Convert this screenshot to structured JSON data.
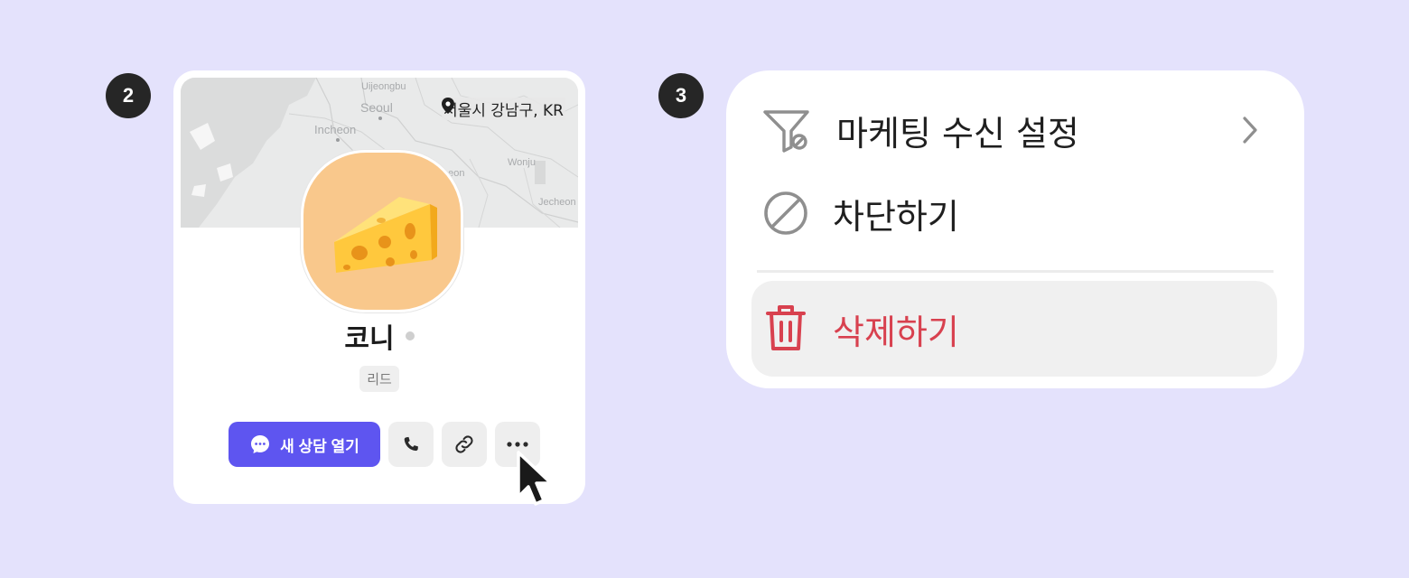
{
  "steps": [
    "2",
    "3"
  ],
  "profile_card": {
    "map_labels": [
      "Uijeongbu",
      "Seoul",
      "Incheon",
      "heon",
      "Wonju",
      "Jecheon"
    ],
    "location": "서울시 강남구, KR",
    "avatar": "cheese-emoji",
    "name": "코니",
    "status_color": "#cfcfcf",
    "tag": "리드",
    "primary_action": "새 상담 열기",
    "icon_actions": [
      "phone-icon",
      "link-icon",
      "more-icon"
    ],
    "accent": "#5e55f0"
  },
  "menu": {
    "items": [
      {
        "label": "마케팅 수신 설정",
        "icon": "marketing-filter-icon",
        "has_submenu": true
      },
      {
        "label": "차단하기",
        "icon": "block-icon"
      }
    ],
    "danger_item": {
      "label": "삭제하기",
      "icon": "trash-icon",
      "color": "#d8414f"
    }
  },
  "background": "#e4e2fc"
}
